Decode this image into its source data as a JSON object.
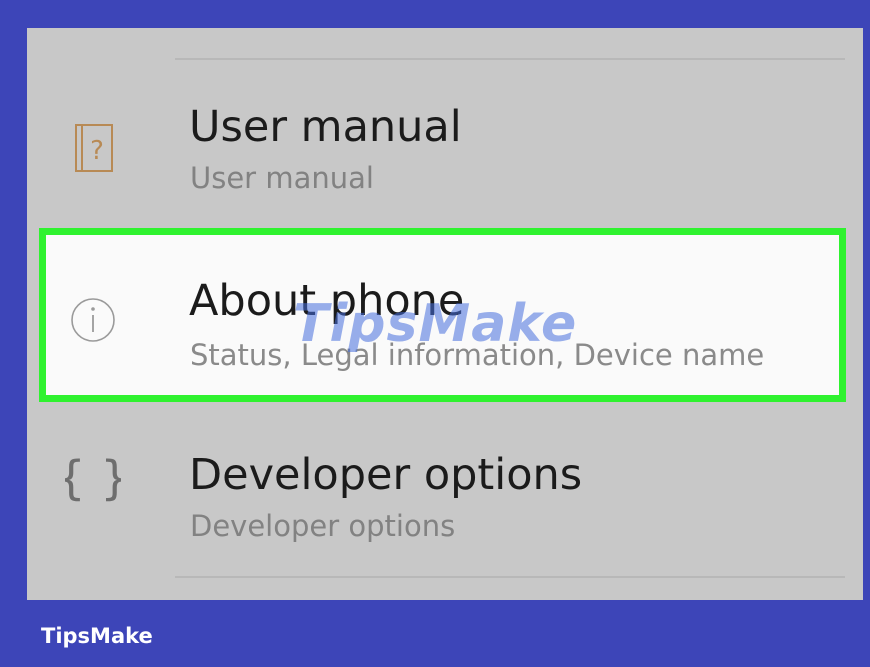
{
  "settings_list": {
    "items": [
      {
        "title": "User manual",
        "subtitle": "User manual",
        "icon": "user-manual-book-icon",
        "icon_color": "#b88a55"
      },
      {
        "title": "About phone",
        "subtitle": "Status, Legal information, Device name",
        "icon": "info-circle-icon",
        "highlighted": true,
        "highlight_color": "#2ff22f"
      },
      {
        "title": "Developer options",
        "subtitle": "Developer options",
        "icon": "braces-icon"
      }
    ]
  },
  "watermark": {
    "center_text": "TipsMake",
    "footer_text": "TipsMake"
  },
  "colors": {
    "frame_background": "#3d45b8",
    "list_background": "#c8c8c8",
    "highlighted_row_background": "#fafafa"
  }
}
